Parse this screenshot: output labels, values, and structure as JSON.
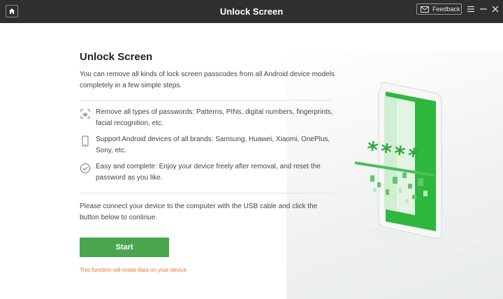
{
  "titlebar": {
    "title": "Unlock Screen",
    "feedback_label": "Feedback"
  },
  "main": {
    "title": "Unlock Screen",
    "subtitle": "You can remove all kinds of lock screen passcodes from all Android device models completely in a few simple steps.",
    "features": [
      {
        "icon": "fingerprint-icon",
        "text": "Remove all types of passwords: Patterns, PINs, digital numbers, fingerprints, facial recognition, etc."
      },
      {
        "icon": "phone-icon",
        "text": "Support Android devices of all brands: Samsung, Huawei, Xiaomi, OnePlus, Sony, etc."
      },
      {
        "icon": "check-circle-icon",
        "text": "Easy and complete: Enjoy your device freely after removal, and reset the password as you like."
      }
    ],
    "instructions": "Please connect your device to the computer with the USB cable and click the button below to continue.",
    "start_label": "Start",
    "warning": "This function will erase data on your device."
  },
  "illustration": {
    "password_mask": "****"
  },
  "colors": {
    "titlebar_bg": "#2f2f2f",
    "accent_green": "#4aa64e",
    "warning_orange": "#e8762d"
  }
}
